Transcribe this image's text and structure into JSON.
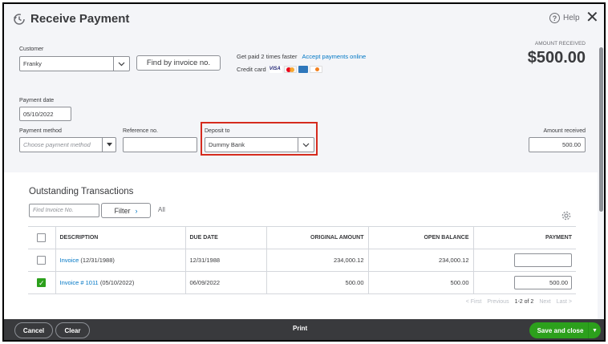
{
  "header": {
    "title": "Receive Payment",
    "help_label": "Help"
  },
  "customer": {
    "label": "Customer",
    "value": "Franky",
    "find_button": "Find by invoice no."
  },
  "payments_promo": {
    "text": "Get paid 2 times faster",
    "link": "Accept payments online",
    "credit_label": "Credit card",
    "cards": [
      "VISA",
      "MC",
      "AMEX",
      "DISC"
    ]
  },
  "amount_received_top": {
    "label": "AMOUNT RECEIVED",
    "value": "$500.00"
  },
  "payment_date": {
    "label": "Payment date",
    "value": "05/10/2022"
  },
  "payment_method": {
    "label": "Payment method",
    "placeholder": "Choose payment method"
  },
  "reference": {
    "label": "Reference no.",
    "value": ""
  },
  "deposit_to": {
    "label": "Deposit to",
    "value": "Dummy Bank"
  },
  "amount_received": {
    "label": "Amount received",
    "value": "500.00"
  },
  "outstanding": {
    "title": "Outstanding Transactions",
    "find_placeholder": "Find Invoice No.",
    "filter_label": "Filter",
    "all_label": "All",
    "columns": [
      "DESCRIPTION",
      "DUE DATE",
      "ORIGINAL AMOUNT",
      "OPEN BALANCE",
      "PAYMENT"
    ],
    "rows": [
      {
        "checked": false,
        "link": "Invoice",
        "desc_rest": " (12/31/1988)",
        "due": "12/31/1988",
        "original": "234,000.12",
        "open": "234,000.12",
        "payment": ""
      },
      {
        "checked": true,
        "link": "Invoice # 1011",
        "desc_rest": " (05/10/2022)",
        "due": "06/09/2022",
        "original": "500.00",
        "open": "500.00",
        "payment": "500.00"
      }
    ],
    "pagination": {
      "first": "< First",
      "previous": "Previous",
      "range": "1-2 of 2",
      "next": "Next",
      "last": "Last >"
    }
  },
  "footer": {
    "cancel": "Cancel",
    "clear": "Clear",
    "print": "Print",
    "save": "Save and close"
  },
  "colors": {
    "accent_green": "#2ca01c",
    "link_blue": "#0077c5",
    "highlight_red": "#d52b1e",
    "footer_bg": "#393a3d"
  }
}
